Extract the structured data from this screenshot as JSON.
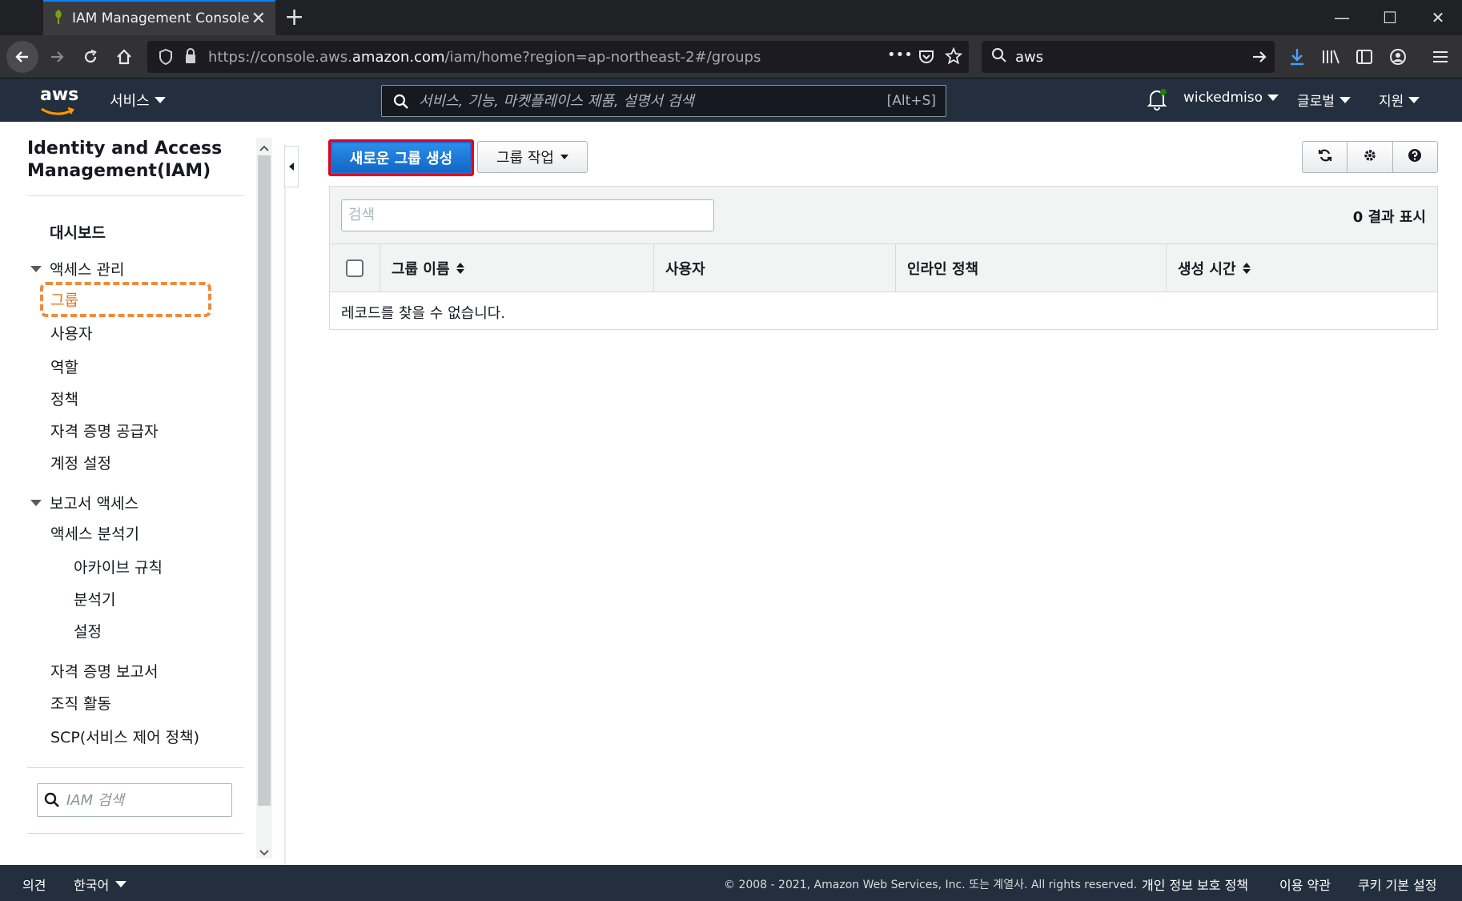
{
  "browser": {
    "tab_title": "IAM Management Console",
    "new_tab": "+",
    "url_prefix": "https://console.aws.",
    "url_host": "amazon.com",
    "url_path": "/iam/home?region=ap-northeast-2#/groups",
    "search_value": "aws",
    "overflow": "•••"
  },
  "aws_header": {
    "logo": "aws",
    "services_label": "서비스",
    "search_placeholder": "서비스, 기능, 마켓플레이스 제품, 설명서 검색",
    "search_shortcut": "[Alt+S]",
    "username": "wickedmiso",
    "region": "글로벌",
    "support": "지원"
  },
  "sidebar": {
    "title": "Identity and Access Management(IAM)",
    "dashboard": "대시보드",
    "access_mgmt": {
      "label": "액세스 관리",
      "items": [
        "그룹",
        "사용자",
        "역할",
        "정책",
        "자격 증명 공급자",
        "계정 설정"
      ]
    },
    "report_access": {
      "label": "보고서 액세스",
      "analyzer": "액세스 분석기",
      "sub_items": [
        "아카이브 규칙",
        "분석기",
        "설정"
      ],
      "items": [
        "자격 증명 보고서",
        "조직 활동",
        "SCP(서비스 제어 정책)"
      ]
    },
    "iam_search_placeholder": "IAM 검색"
  },
  "main": {
    "create_group": "새로운 그룹 생성",
    "group_actions": "그룹 작업",
    "search_placeholder": "검색",
    "result_count": "0 결과 표시",
    "columns": [
      "그룹 이름",
      "사용자",
      "인라인 정책",
      "생성 시간"
    ],
    "empty_message": "레코드를 찾을 수 없습니다."
  },
  "footer": {
    "feedback": "의견",
    "language": "한국어",
    "copyright": "© 2008 - 2021, Amazon Web Services, Inc. 또는 계열사. All rights reserved.",
    "privacy": "개인 정보 보호 정책",
    "terms": "이용 약관",
    "cookies": "쿠키 기본 설정"
  },
  "colors": {
    "aws_navy": "#232f3e",
    "primary_blue": "#1a6ed8",
    "highlight_red": "#e3001b",
    "active_orange": "#ec7211"
  }
}
